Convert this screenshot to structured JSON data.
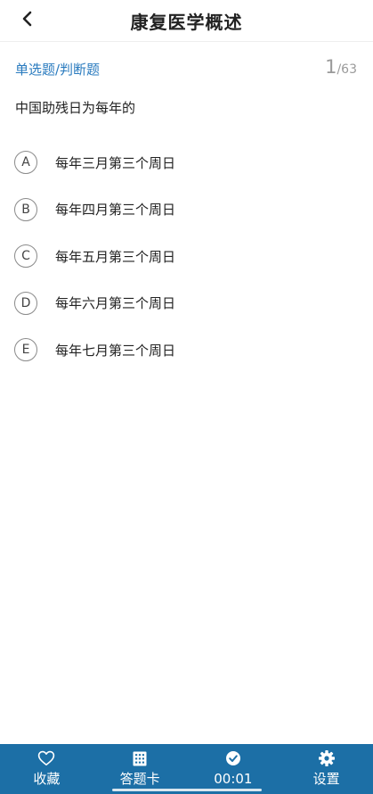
{
  "header": {
    "title": "康复医学概述"
  },
  "question_meta": {
    "type_label": "单选题/判断题",
    "current": "1",
    "separator": "/",
    "total": "63"
  },
  "question": {
    "text": "中国助残日为每年的"
  },
  "options": [
    {
      "letter": "A",
      "text": "每年三月第三个周日"
    },
    {
      "letter": "B",
      "text": "每年四月第三个周日"
    },
    {
      "letter": "C",
      "text": "每年五月第三个周日"
    },
    {
      "letter": "D",
      "text": "每年六月第三个周日"
    },
    {
      "letter": "E",
      "text": "每年七月第三个周日"
    }
  ],
  "bottom_bar": {
    "favorite_label": "收藏",
    "answer_card_label": "答题卡",
    "timer_label": "00:01",
    "settings_label": "设置"
  },
  "colors": {
    "accent": "#2a7bbf",
    "bottom_bar_bg": "#1c6fa6",
    "muted": "#9a9a9a"
  },
  "icons": {
    "back": "chevron-left-icon",
    "favorite": "heart-icon",
    "answer_card": "grid-icon",
    "timer": "clock-icon",
    "settings": "gear-icon"
  }
}
